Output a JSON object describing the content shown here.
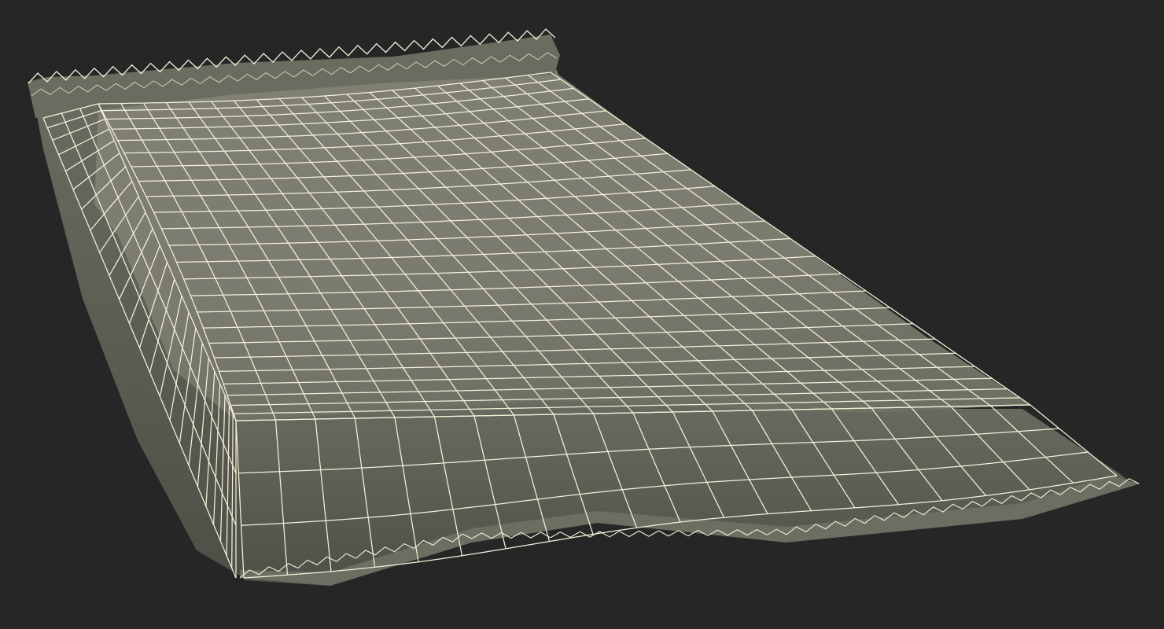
{
  "scene": {
    "subject": "wireframe-snack-bag",
    "background_color": "#262626",
    "surface_color": "#7c7d70",
    "surface_shadow_color": "#55564c",
    "wire_color": "#f4f1da"
  }
}
